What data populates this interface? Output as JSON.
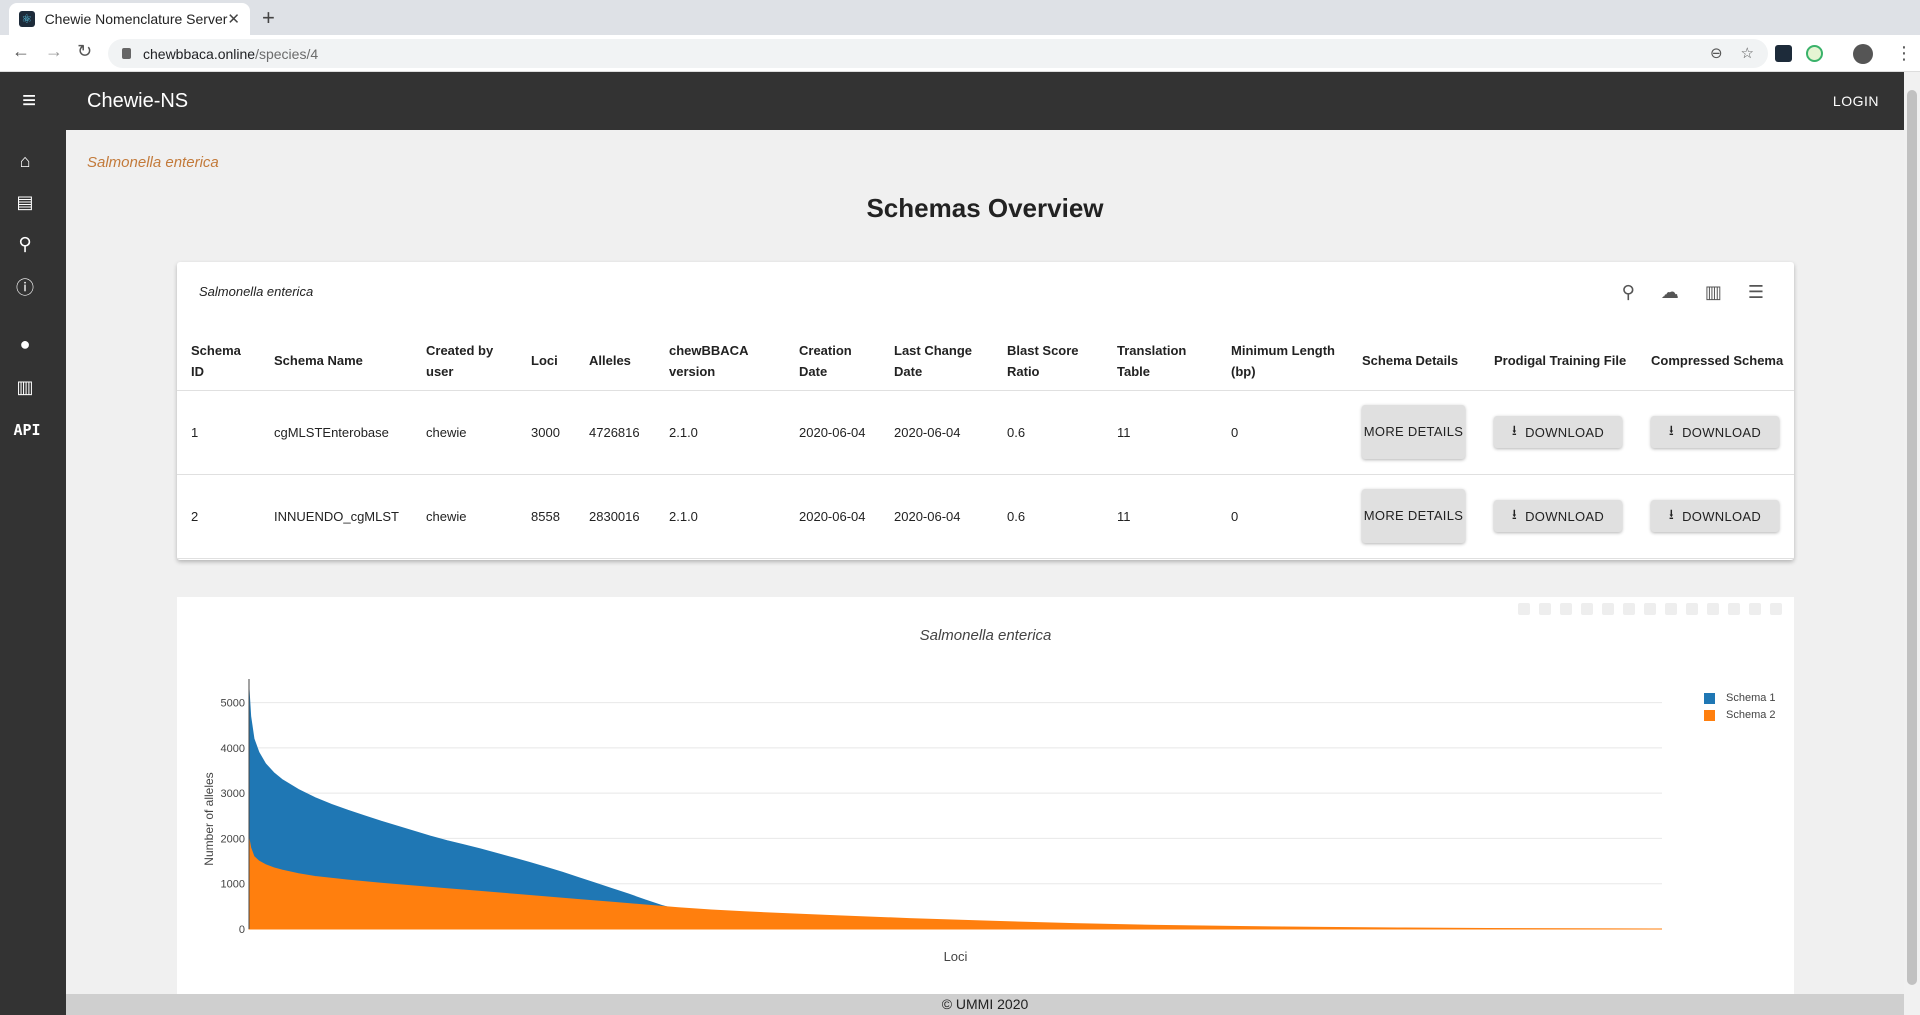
{
  "browser": {
    "tab_title": "Chewie Nomenclature Server",
    "url_host": "chewbbaca.online",
    "url_path": "/species/4"
  },
  "appbar": {
    "title": "Chewie-NS",
    "login_label": "LOGIN"
  },
  "drawer": {
    "api_label": "API"
  },
  "page": {
    "species_link": "Salmonella enterica",
    "heading": "Schemas Overview"
  },
  "table": {
    "title": "Salmonella enterica",
    "headers": {
      "schema_id": "Schema ID",
      "schema_name": "Schema Name",
      "created_by": "Created by user",
      "loci": "Loci",
      "alleles": "Alleles",
      "chewbbaca_version": "chewBBACA version",
      "creation_date": "Creation Date",
      "last_change_date": "Last Change Date",
      "blast_score_ratio": "Blast Score Ratio",
      "translation_table": "Translation Table",
      "minimum_length": "Minimum Length (bp)",
      "schema_details": "Schema Details",
      "prodigal_training_file": "Prodigal Training File",
      "compressed_schema": "Compressed Schema"
    },
    "rows": [
      {
        "schema_id": "1",
        "schema_name": "cgMLSTEnterobase",
        "created_by": "chewie",
        "loci": "3000",
        "alleles": "4726816",
        "chewbbaca_version": "2.1.0",
        "creation_date": "2020-06-04",
        "last_change_date": "2020-06-04",
        "blast_score_ratio": "0.6",
        "translation_table": "11",
        "minimum_length": "0",
        "details_label": "MORE DETAILS",
        "download_label": "DOWNLOAD"
      },
      {
        "schema_id": "2",
        "schema_name": "INNUENDO_cgMLST",
        "created_by": "chewie",
        "loci": "8558",
        "alleles": "2830016",
        "chewbbaca_version": "2.1.0",
        "creation_date": "2020-06-04",
        "last_change_date": "2020-06-04",
        "blast_score_ratio": "0.6",
        "translation_table": "11",
        "minimum_length": "0",
        "details_label": "MORE DETAILS",
        "download_label": "DOWNLOAD"
      }
    ]
  },
  "chart_data": {
    "type": "area",
    "title": "Salmonella enterica",
    "xlabel": "Loci",
    "ylabel": "Number of alleles",
    "ylim": [
      0,
      5300
    ],
    "yticks": [
      0,
      1000,
      2000,
      3000,
      4000,
      5000
    ],
    "grid": true,
    "legend_position": "top-right",
    "series": [
      {
        "name": "Schema 1",
        "color": "#1f77b4",
        "x": [
          0,
          10,
          30,
          60,
          100,
          150,
          200,
          300,
          400,
          500,
          600,
          700,
          800,
          900,
          1000,
          1100,
          1200,
          1300,
          1400,
          1500,
          1600,
          1700,
          1800,
          1900,
          2000,
          2100,
          2200,
          2300,
          2400,
          2500,
          2600,
          2700,
          2800,
          2900,
          3000
        ],
        "y": [
          5300,
          4700,
          4200,
          3900,
          3650,
          3450,
          3300,
          3080,
          2900,
          2750,
          2620,
          2500,
          2380,
          2270,
          2160,
          2050,
          1950,
          1860,
          1770,
          1670,
          1570,
          1470,
          1360,
          1250,
          1130,
          1010,
          890,
          770,
          640,
          520,
          420,
          340,
          250,
          150,
          0
        ]
      },
      {
        "name": "Schema 2",
        "color": "#ff7f0e",
        "x": [
          0,
          10,
          30,
          60,
          100,
          150,
          200,
          300,
          400,
          600,
          800,
          1000,
          1200,
          1400,
          1600,
          1800,
          2000,
          2200,
          2400,
          2600,
          2800,
          3000,
          3500,
          4000,
          4500,
          5000,
          5500,
          6000,
          6500,
          7000,
          7500,
          8000,
          8558
        ],
        "y": [
          2000,
          1800,
          1600,
          1500,
          1420,
          1350,
          1300,
          1220,
          1160,
          1080,
          1010,
          950,
          890,
          830,
          770,
          710,
          650,
          590,
          530,
          470,
          420,
          380,
          300,
          230,
          170,
          120,
          80,
          55,
          35,
          22,
          12,
          6,
          0
        ]
      }
    ]
  },
  "footer": {
    "text": "© UMMI 2020"
  }
}
